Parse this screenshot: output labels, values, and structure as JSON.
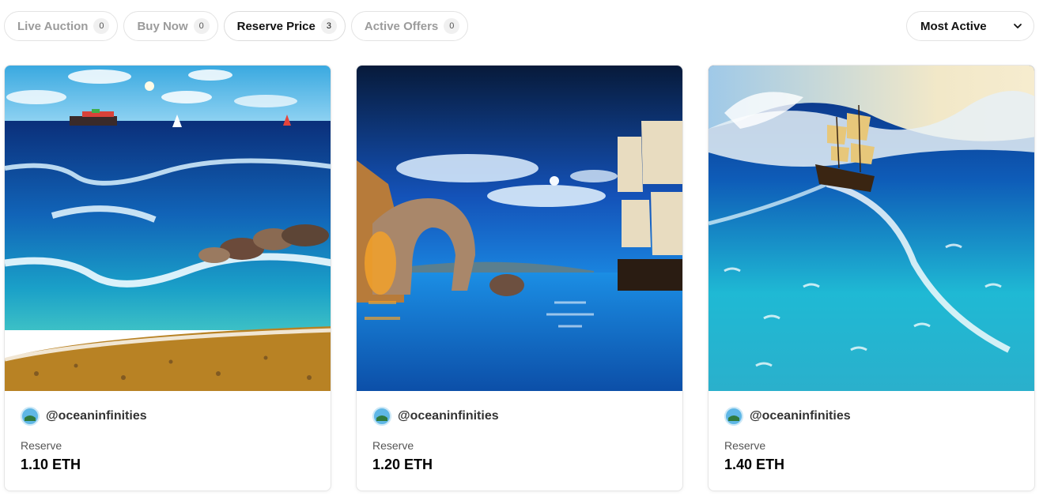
{
  "filters": [
    {
      "label": "Live Auction",
      "count": "0",
      "active": false
    },
    {
      "label": "Buy Now",
      "count": "0",
      "active": false
    },
    {
      "label": "Reserve Price",
      "count": "3",
      "active": true
    },
    {
      "label": "Active Offers",
      "count": "0",
      "active": false
    }
  ],
  "sort": {
    "label": "Most Active",
    "icon": "chevron-down-icon"
  },
  "cards": [
    {
      "artwork": "seascape with cargo ship, sailboats, rocks and pebble beach",
      "creator": "@oceaninfinities",
      "price_label": "Reserve",
      "price": "1.10 ETH"
    },
    {
      "artwork": "rock arch at night with moon and tall ship",
      "creator": "@oceaninfinities",
      "price_label": "Reserve",
      "price": "1.20 ETH"
    },
    {
      "artwork": "sailing ship on a giant turquoise wave",
      "creator": "@oceaninfinities",
      "price_label": "Reserve",
      "price": "1.40 ETH"
    }
  ]
}
